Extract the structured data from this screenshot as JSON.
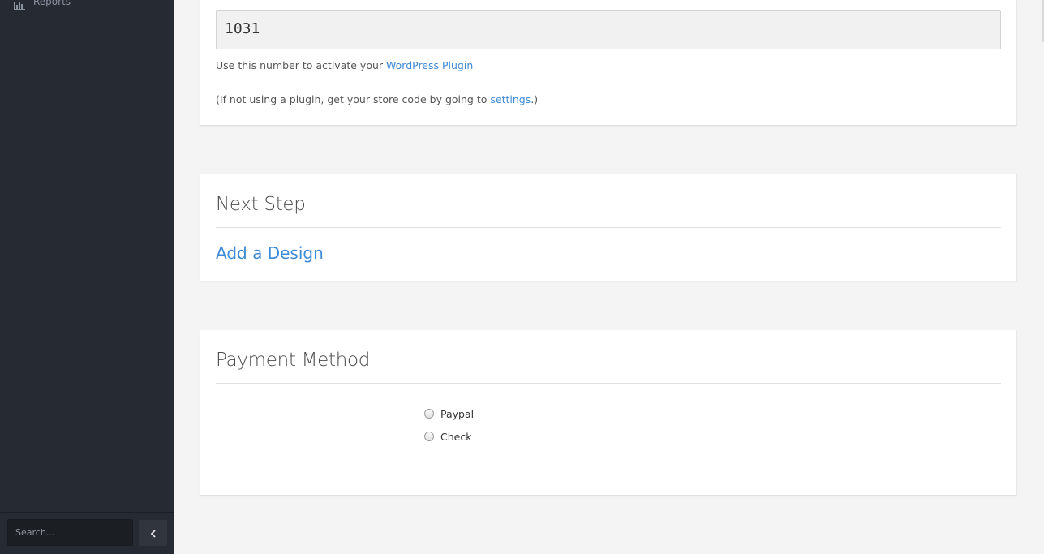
{
  "sidebar": {
    "top_item_label": "Reports",
    "search_placeholder": "Search...",
    "collapse_icon": "chevron-left-icon"
  },
  "store_panel": {
    "store_code": "1031",
    "activate_prefix": "Use this number to activate your ",
    "activate_link": "WordPress Plugin",
    "settings_prefix": "(If not using a plugin, get your store code by going to ",
    "settings_link": "settings",
    "settings_suffix": ".)"
  },
  "next_step_panel": {
    "heading": "Next Step",
    "link": "Add a Design"
  },
  "payment_panel": {
    "heading": "Payment Method",
    "options": [
      {
        "label": "Paypal",
        "selected": false
      },
      {
        "label": "Check",
        "selected": false
      }
    ]
  },
  "colors": {
    "sidebar_bg": "#262a32",
    "page_bg": "#f4f4f4",
    "link": "#3d8ad6"
  }
}
